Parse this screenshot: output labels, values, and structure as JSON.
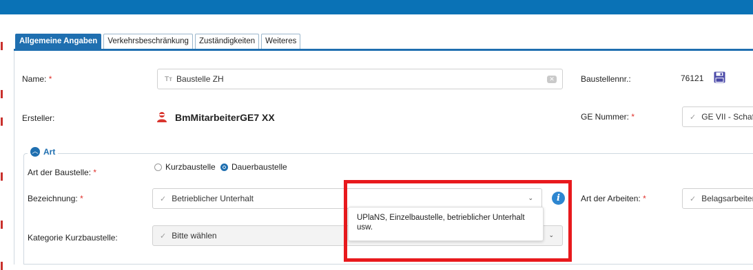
{
  "tabs": [
    {
      "label": "Allgemeine Angaben",
      "active": true
    },
    {
      "label": "Verkehrsbeschränkung",
      "active": false
    },
    {
      "label": "Zuständigkeiten",
      "active": false
    },
    {
      "label": "Weiteres",
      "active": false
    }
  ],
  "required_mark": "*",
  "name": {
    "label": "Name:",
    "value": "Baustelle ZH",
    "type_icon": "Tт"
  },
  "baustellennr": {
    "label": "Baustellennr.:",
    "value": "76121"
  },
  "ersteller": {
    "label": "Ersteller:",
    "value": "BmMitarbeiterGE7 XX"
  },
  "ge_nummer": {
    "label": "GE Nummer:",
    "value": "GE VII - Schaf"
  },
  "art": {
    "legend": "Art",
    "art_der_baustelle_label": "Art der Baustelle:",
    "option_kurz": "Kurzbaustelle",
    "option_dauer": "Dauerbaustelle",
    "selected": "Dauerbaustelle",
    "bezeichnung_label": "Bezeichnung:",
    "bezeichnung_value": "Betrieblicher Unterhalt",
    "art_der_arbeiten_label": "Art der Arbeiten:",
    "art_der_arbeiten_value": "Belagsarbeiten",
    "kategorie_label": "Kategorie Kurzbaustelle:",
    "kategorie_placeholder": "Bitte wählen"
  },
  "tooltip": {
    "text": "UPlaNS, Einzelbaustelle, betrieblicher Unterhalt usw."
  },
  "colors": {
    "accent": "#1f6fb0",
    "topbar": "#0a72b6",
    "required": "#e0302a",
    "highlight": "#e8191d"
  }
}
